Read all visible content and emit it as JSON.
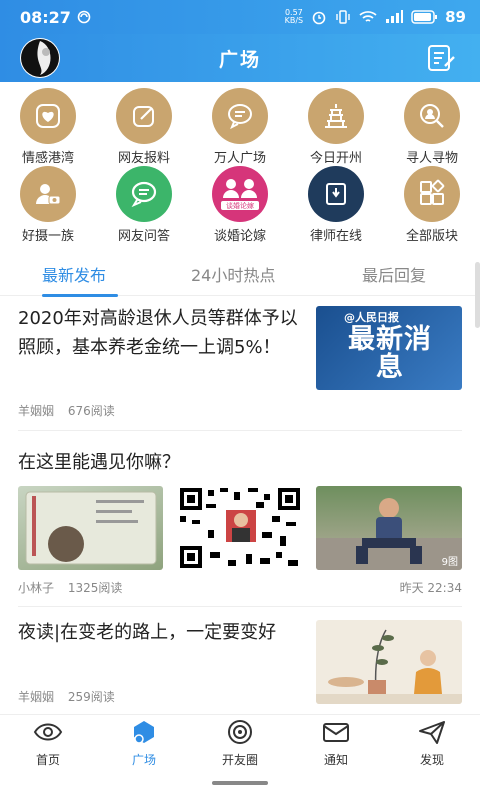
{
  "status": {
    "time": "08:27",
    "net_speed": "0.57",
    "net_unit": "KB/S",
    "battery": "89"
  },
  "header": {
    "title": "广场"
  },
  "grid": [
    {
      "label": "情感港湾",
      "icon": "heart-icon",
      "color": "#c9a56f"
    },
    {
      "label": "网友报料",
      "icon": "edit-icon",
      "color": "#c9a56f"
    },
    {
      "label": "万人广场",
      "icon": "chat-bubble-icon",
      "color": "#c9a56f"
    },
    {
      "label": "今日开州",
      "icon": "pagoda-icon",
      "color": "#c9a56f"
    },
    {
      "label": "寻人寻物",
      "icon": "search-person-icon",
      "color": "#c9a56f"
    },
    {
      "label": "好摄一族",
      "icon": "camera-person-icon",
      "color": "#c9a56f"
    },
    {
      "label": "网友问答",
      "icon": "chat-green-icon",
      "color": "#3cb56a"
    },
    {
      "label": "谈婚论嫁",
      "icon": "wedding-logo-icon",
      "color": "#d6357a"
    },
    {
      "label": "律师在线",
      "icon": "lawyer-icon",
      "color": "#1f3b5c"
    },
    {
      "label": "全部版块",
      "icon": "grid-blocks-icon",
      "color": "#c9a56f"
    }
  ],
  "tabs": [
    "最新发布",
    "24小时热点",
    "最后回复"
  ],
  "posts": [
    {
      "title": "2020年对高龄退休人员等群体予以照顾，基本养老金统一上调5%！",
      "author": "羊姻姻",
      "reads": "676阅读",
      "image_text_top": "@人民日报",
      "image_text_main": "最新消息"
    },
    {
      "title": "在这里能遇见你嘛？",
      "author": "小林子",
      "reads": "1325阅读",
      "time": "昨天 22:34",
      "image_count": "9图"
    },
    {
      "title": "夜读|在变老的路上，一定要变好",
      "author": "羊姻姻",
      "reads": "259阅读"
    }
  ],
  "nav": [
    {
      "label": "首页",
      "icon": "eye-icon"
    },
    {
      "label": "广场",
      "icon": "plaza-icon"
    },
    {
      "label": "开友圈",
      "icon": "circle-icon"
    },
    {
      "label": "通知",
      "icon": "mail-icon"
    },
    {
      "label": "发现",
      "icon": "paper-plane-icon"
    }
  ],
  "colors": {
    "accent": "#2f8de4",
    "gold": "#c9a56f"
  }
}
